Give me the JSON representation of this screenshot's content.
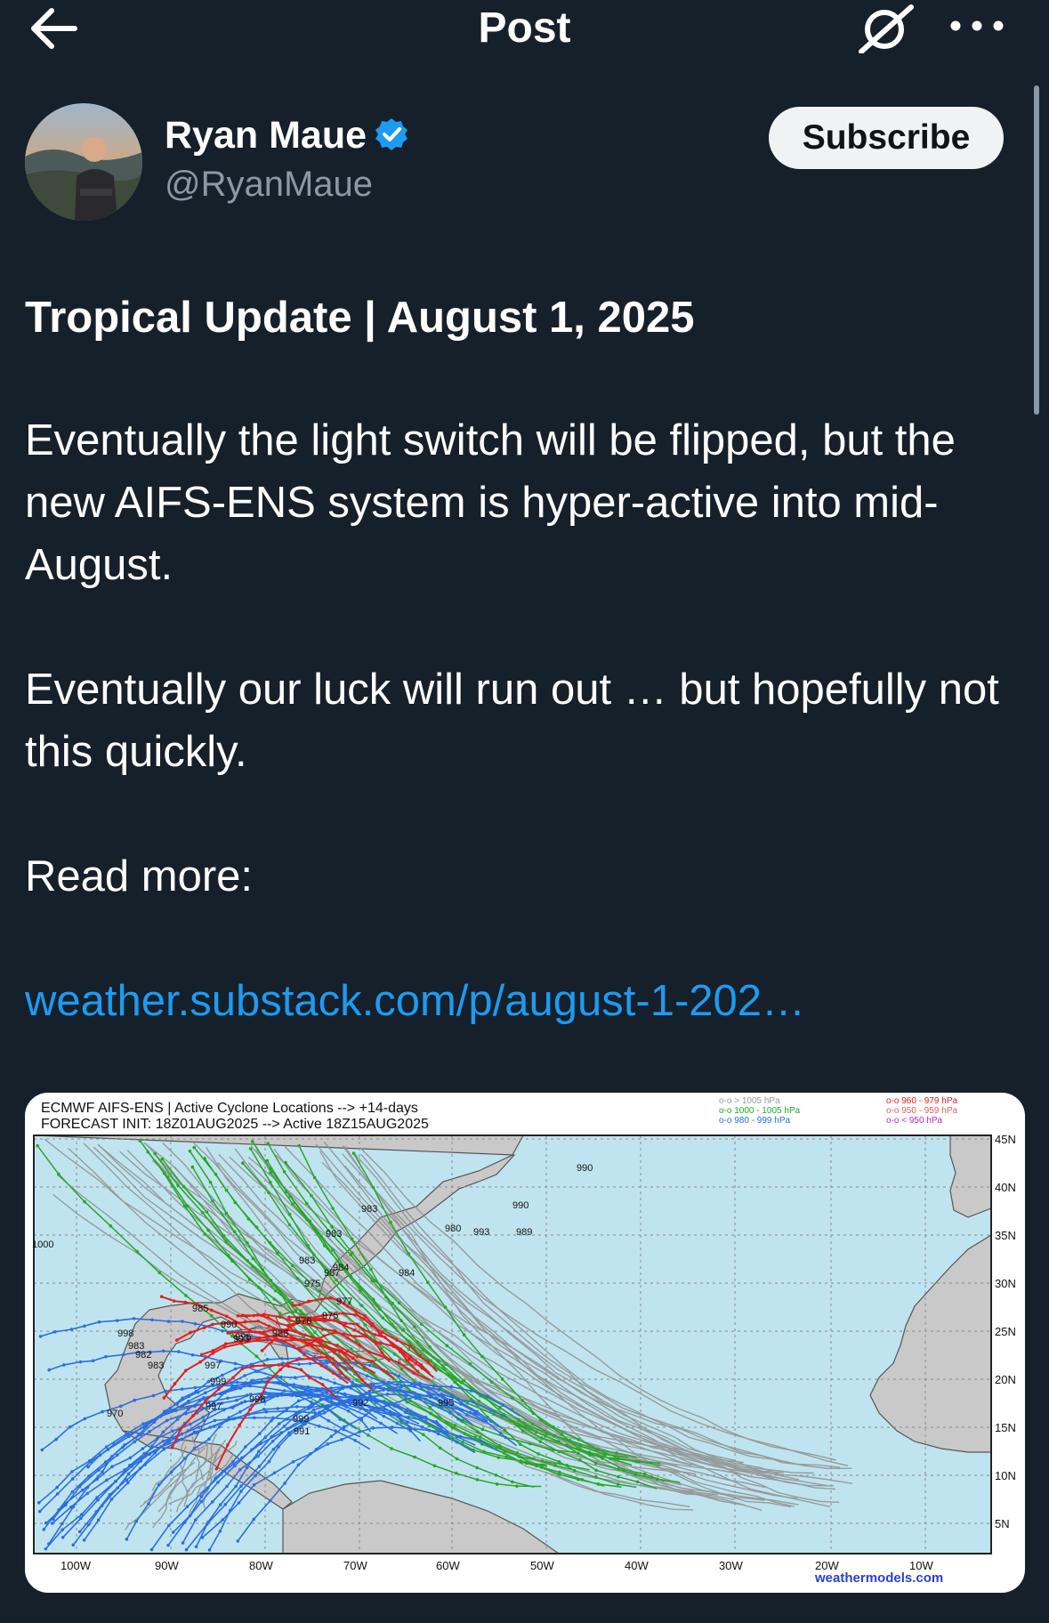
{
  "header": {
    "title": "Post"
  },
  "author": {
    "name": "Ryan Maue",
    "handle": "@RyanMaue",
    "subscribe_label": "Subscribe"
  },
  "post": {
    "headline": "Tropical Update | August 1, 2025",
    "paragraph1": "Eventually the light switch will be flipped, but the new AIFS-ENS system is hyper-active into mid-August.",
    "paragraph2": "Eventually our luck will run out … but hopefully not this quickly.",
    "read_more": "Read more:",
    "link": "weather.substack.com/p/august-1-202…"
  },
  "map": {
    "title_line1": "ECMWF AIFS-ENS | Active Cyclone Locations --> +14-days",
    "title_line2": "FORECAST INIT: 18Z01AUG2025 --> Active 18Z15AUG2025",
    "legend_left": [
      "o-o > 1005 hPa",
      "o-o 1000 - 1005 hPa",
      "o-o 980 - 999 hPa"
    ],
    "legend_right": [
      "o-o 960 - 979 hPa",
      "o-o 950 - 959 hPa",
      "o-o < 950 hPa"
    ],
    "legend_left_colors": [
      "#9a9a9a",
      "#22aa22",
      "#2b6fe0"
    ],
    "legend_right_colors": [
      "#e02020",
      "#e06060",
      "#cc22cc"
    ],
    "lon_labels": [
      "100W",
      "90W",
      "80W",
      "70W",
      "60W",
      "50W",
      "40W",
      "30W",
      "20W",
      "10W"
    ],
    "lat_labels": [
      "45N",
      "40N",
      "35N",
      "30N",
      "25N",
      "20N",
      "15N",
      "10N",
      "5N"
    ],
    "pressure_labels": [
      "990",
      "983",
      "983",
      "990",
      "980",
      "993",
      "989",
      "1000",
      "983",
      "984",
      "987",
      "984",
      "977",
      "975",
      "976",
      "975",
      "985",
      "996",
      "990",
      "988",
      "993",
      "998",
      "983",
      "982",
      "983",
      "997",
      "999",
      "998",
      "992",
      "995",
      "997",
      "999",
      "991",
      "970"
    ],
    "credit": "weathermodels.com"
  }
}
